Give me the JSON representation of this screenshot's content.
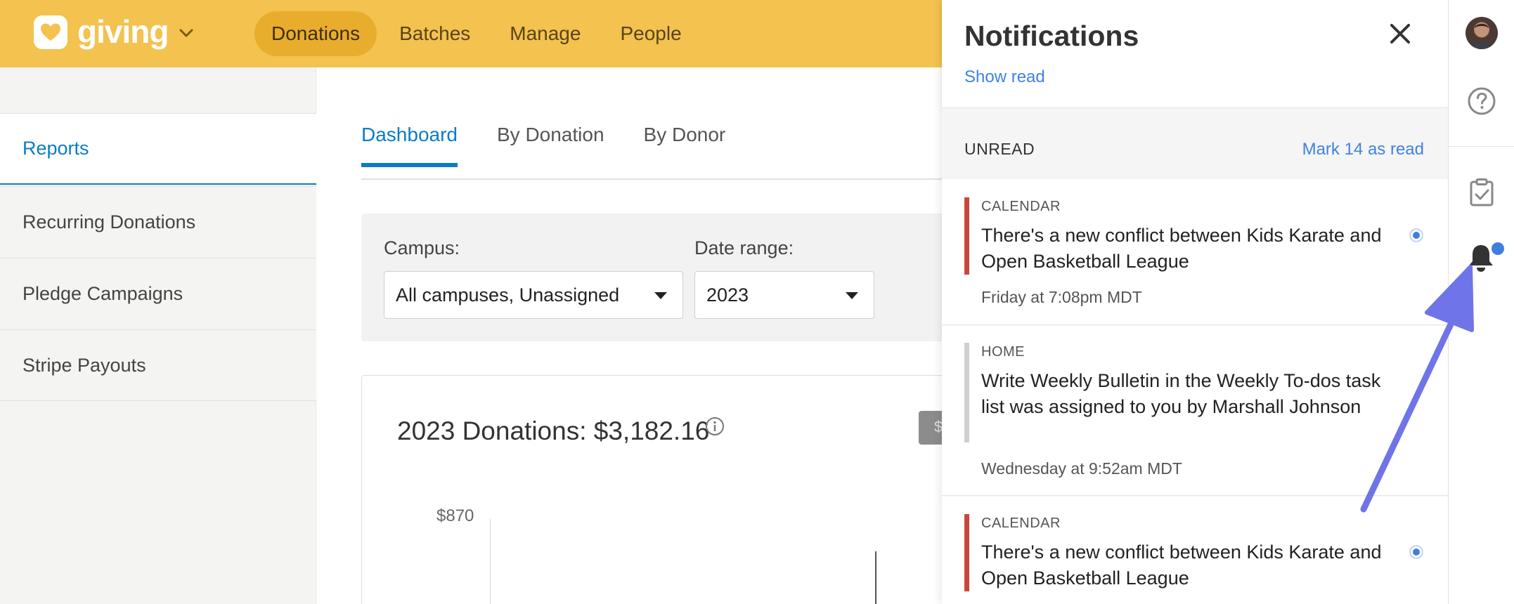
{
  "header": {
    "app_name": "giving",
    "nav": [
      "Donations",
      "Batches",
      "Manage",
      "People"
    ]
  },
  "sidebar": {
    "items": [
      {
        "label": "Reports"
      },
      {
        "label": "Recurring Donations"
      },
      {
        "label": "Pledge Campaigns"
      },
      {
        "label": "Stripe Payouts"
      }
    ]
  },
  "main": {
    "tabs": [
      "Dashboard",
      "By Donation",
      "By Donor"
    ],
    "filters": {
      "campus_label": "Campus:",
      "campus_value": "All campuses, Unassigned",
      "date_label": "Date range:",
      "date_value": "2023"
    },
    "card": {
      "title": "2023 Donations: $3,182.16",
      "button_partial": "$",
      "y_tick": "$870"
    }
  },
  "notifications": {
    "title": "Notifications",
    "show_read": "Show read",
    "section_label": "UNREAD",
    "mark_read": "Mark 14 as read",
    "items": [
      {
        "category": "CALENDAR",
        "text": "There's a new conflict between Kids Karate and Open Basketball League",
        "time": "Friday at 7:08pm MDT"
      },
      {
        "category": "HOME",
        "text": "Write Weekly Bulletin in the Weekly To-dos task list was assigned to you by Marshall Johnson",
        "time": "Wednesday at 9:52am MDT"
      },
      {
        "category": "CALENDAR",
        "text": "There's a new conflict between Kids Karate and Open Basketball League",
        "time": ""
      }
    ]
  },
  "colors": {
    "header_bg": "#f3c24f",
    "active_nav_bg": "#e9ad2d",
    "accent_blue": "#0b7cc4",
    "link_blue": "#3f82e0",
    "calendar_bar": "#c8473a",
    "home_bar": "#cfcfcf",
    "arrow": "#6f74e8"
  },
  "icons": {
    "logo": "heart-icon",
    "close": "close-icon",
    "help": "help-icon",
    "tasks": "clipboard-check-icon",
    "notifications": "bell-icon",
    "info": "info-icon"
  }
}
